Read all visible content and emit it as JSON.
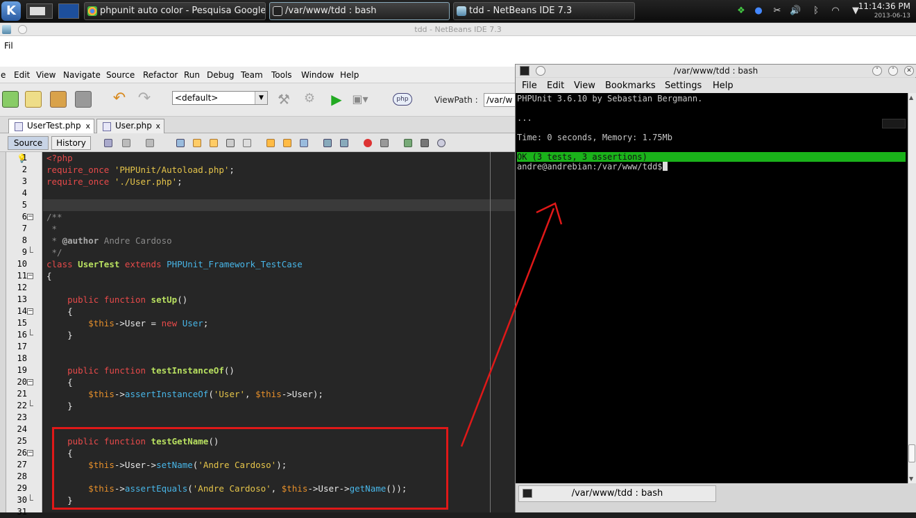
{
  "taskbar": {
    "tasks": [
      {
        "label": "phpunit auto color - Pesquisa Google"
      },
      {
        "label": "/var/www/tdd : bash"
      },
      {
        "label": "tdd - NetBeans IDE 7.3"
      }
    ],
    "clock_time": "11:14:36 PM",
    "clock_date": "2013-06-13"
  },
  "netbeans": {
    "window_title": "tdd - NetBeans IDE 7.3",
    "file_menu_partial": "Fil",
    "menu": [
      "e",
      "Edit",
      "View",
      "Navigate",
      "Source",
      "Refactor",
      "Run",
      "Debug",
      "Team",
      "Tools",
      "Window",
      "Help"
    ],
    "config": "<default>",
    "viewpath_label": "ViewPath :",
    "viewpath_value": "/var/w",
    "tabs": [
      {
        "label": "UserTest.php",
        "close": "x"
      },
      {
        "label": "User.php",
        "close": "x"
      }
    ],
    "source_tab": "Source",
    "history_tab": "History",
    "line_numbers": [
      "1",
      "2",
      "3",
      "4",
      "5",
      "6",
      "7",
      "8",
      "9",
      "10",
      "11",
      "12",
      "13",
      "14",
      "15",
      "16",
      "17",
      "18",
      "19",
      "20",
      "21",
      "22",
      "23",
      "24",
      "25",
      "26",
      "27",
      "28",
      "29",
      "30",
      "31"
    ],
    "code": [
      "<?php",
      "require_once 'PHPUnit/Autoload.php';",
      "require_once './User.php';",
      "",
      "",
      "/**",
      " *",
      " * @author Andre Cardoso",
      " */",
      "class UserTest extends PHPUnit_Framework_TestCase",
      "{",
      "",
      "    public function setUp()",
      "    {",
      "        $this->User = new User;",
      "    }",
      "",
      "",
      "    public function testInstanceOf()",
      "    {",
      "        $this->assertInstanceOf('User', $this->User);",
      "    }",
      "",
      "",
      "    public function testGetName()",
      "    {",
      "        $this->User->setName('Andre Cardoso');",
      "",
      "        $this->assertEquals('Andre Cardoso', $this->User->getName());",
      "    }",
      ""
    ]
  },
  "terminal": {
    "title": "/var/www/tdd : bash",
    "menu": [
      "File",
      "Edit",
      "View",
      "Bookmarks",
      "Settings",
      "Help"
    ],
    "lines": [
      "PHPUnit 3.6.10 by Sebastian Bergmann.",
      "",
      "...",
      "",
      "Time: 0 seconds, Memory: 1.75Mb",
      "",
      "OK (3 tests, 3 assertions)",
      "andre@andrebian:/var/www/tdd$ "
    ],
    "tab_label": "/var/www/tdd : bash",
    "ok_color": "#1ab21a"
  },
  "annotation": {
    "box_color": "#e01818",
    "arrow_color": "#e01818"
  }
}
